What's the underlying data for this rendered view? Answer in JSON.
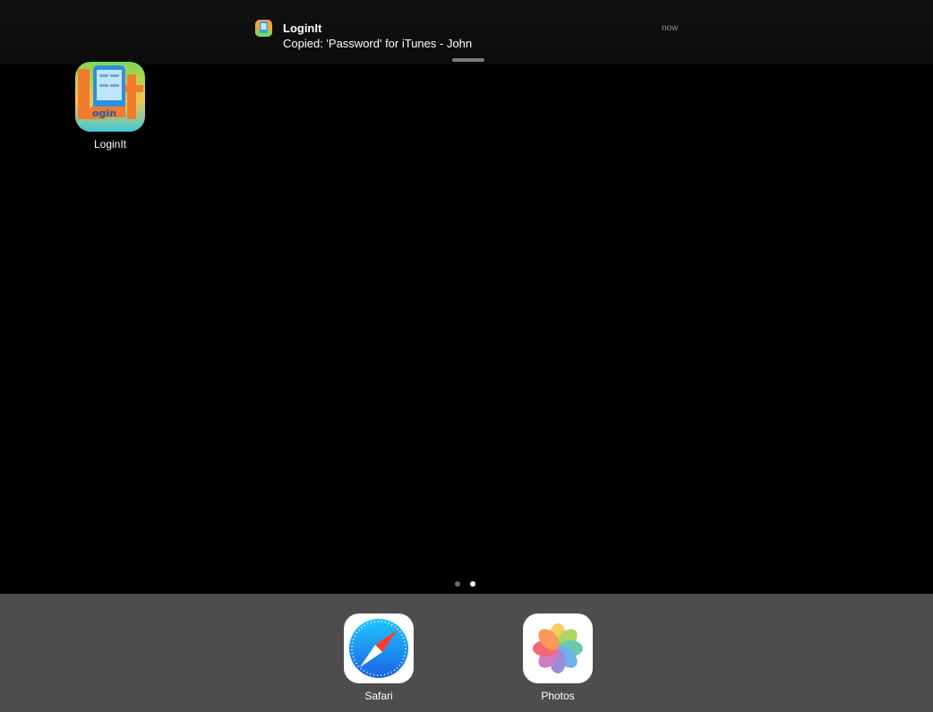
{
  "notification": {
    "app_name": "LoginIt",
    "message": "Copied: 'Password' for iTunes - John",
    "time": "now",
    "icon": "loginit-app-icon"
  },
  "home": {
    "apps": [
      {
        "label": "LoginIt",
        "icon": "loginit-app-icon"
      }
    ],
    "page_indicator": {
      "pages": 2,
      "current": 2
    }
  },
  "dock": {
    "apps": [
      {
        "label": "Safari",
        "icon": "safari-compass-icon"
      },
      {
        "label": "Photos",
        "icon": "photos-flower-icon"
      }
    ]
  },
  "colors": {
    "background": "#000000",
    "dock": "#4d4d4d",
    "safari_blue": "#1e8ef0",
    "loginit_green": "#7ed957",
    "loginit_orange": "#f27c2b"
  }
}
